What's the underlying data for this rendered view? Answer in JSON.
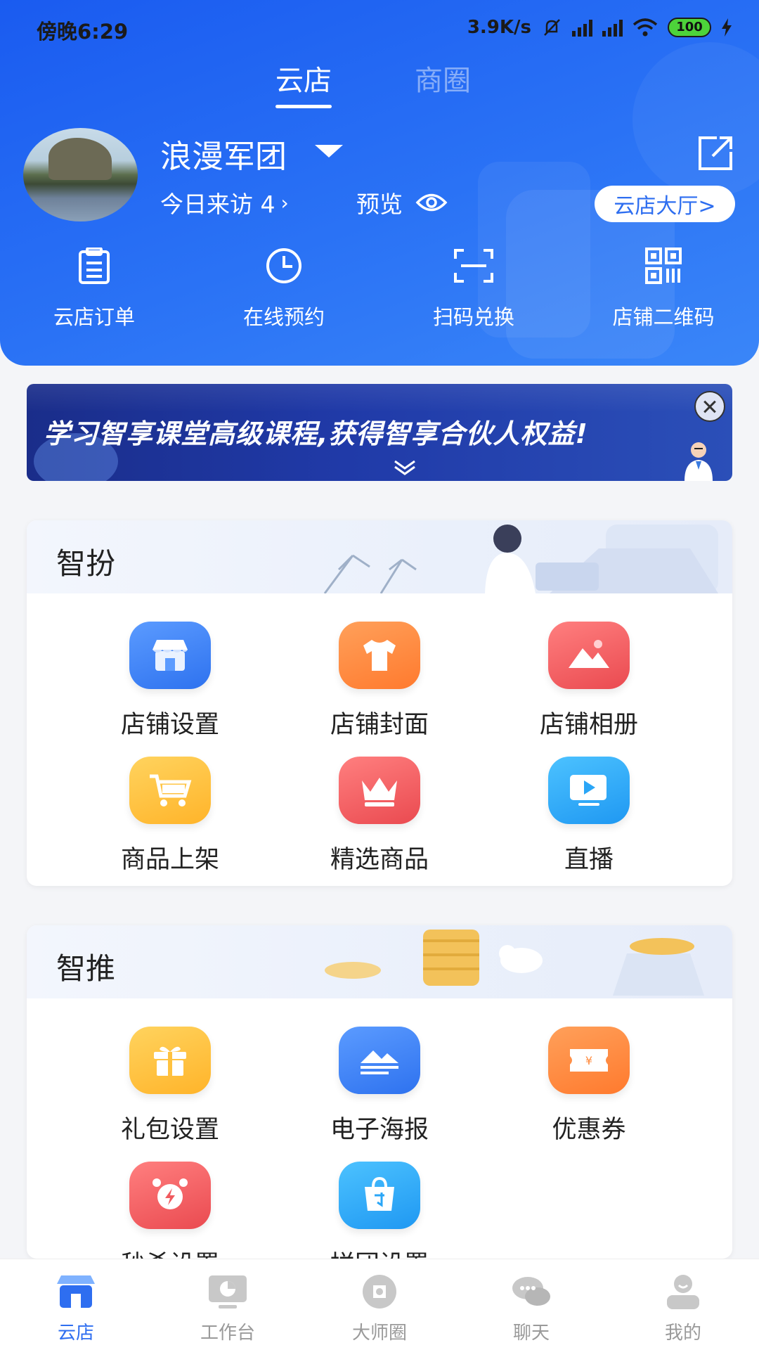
{
  "status_bar": {
    "time": "傍晚6:29",
    "speed": "3.9K/s",
    "battery": "100"
  },
  "top_tabs": [
    {
      "label": "云店",
      "active": true
    },
    {
      "label": "商圈",
      "active": false
    }
  ],
  "shop": {
    "name": "浪漫军团",
    "visits_label": "今日来访 4",
    "preview_label": "预览",
    "hall_button": "云店大厅>"
  },
  "quick_actions": [
    {
      "label": "云店订单",
      "icon": "order-list-icon"
    },
    {
      "label": "在线预约",
      "icon": "clock-icon"
    },
    {
      "label": "扫码兑换",
      "icon": "scan-icon"
    },
    {
      "label": "店铺二维码",
      "icon": "qrcode-icon"
    }
  ],
  "banner": {
    "text": "学习智享课堂高级课程,获得智享合伙人权益!"
  },
  "sections": [
    {
      "title": "智扮",
      "items": [
        {
          "label": "店铺设置",
          "icon": "store-icon",
          "color": "#3f86f7"
        },
        {
          "label": "店铺封面",
          "icon": "tshirt-icon",
          "color": "#ff8a3c"
        },
        {
          "label": "店铺相册",
          "icon": "photo-icon",
          "color": "#f05a5e"
        },
        {
          "label": "商品上架",
          "icon": "cart-icon",
          "color": "#ffc23f"
        },
        {
          "label": "精选商品",
          "icon": "crown-icon",
          "color": "#f05a5e"
        },
        {
          "label": "直播",
          "icon": "live-video-icon",
          "color": "#2aa6f7"
        }
      ]
    },
    {
      "title": "智推",
      "items": [
        {
          "label": "礼包设置",
          "icon": "gift-icon",
          "color": "#ffc23f"
        },
        {
          "label": "电子海报",
          "icon": "poster-icon",
          "color": "#3f86f7"
        },
        {
          "label": "优惠券",
          "icon": "coupon-icon",
          "color": "#ff8a3c"
        },
        {
          "label": "秒杀设置",
          "icon": "alarm-clock-icon",
          "color": "#f05a5e"
        },
        {
          "label": "拼团设置",
          "icon": "shopping-bag-icon",
          "color": "#2aa6f7"
        }
      ]
    }
  ],
  "bottom_nav": [
    {
      "label": "云店",
      "icon": "store-tab-icon",
      "active": true
    },
    {
      "label": "工作台",
      "icon": "workbench-tab-icon",
      "active": false
    },
    {
      "label": "大师圈",
      "icon": "master-circle-tab-icon",
      "active": false
    },
    {
      "label": "聊天",
      "icon": "chat-tab-icon",
      "active": false
    },
    {
      "label": "我的",
      "icon": "profile-tab-icon",
      "active": false
    }
  ],
  "colors": {
    "header_blue": "#2a6ff3",
    "accent_blue": "#2e6ef0",
    "inactive_gray": "#9a9a9a"
  }
}
